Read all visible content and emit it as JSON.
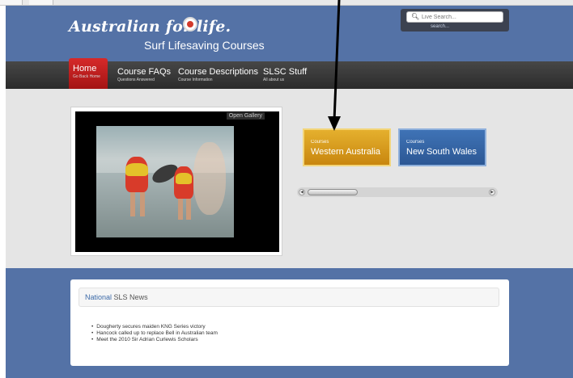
{
  "header": {
    "logo_script": "Australian for life.",
    "logo_subtitle": "Surf Lifesaving Courses",
    "search_placeholder": "Live Search...",
    "search_link": "search..."
  },
  "nav": {
    "items": [
      {
        "label": "Home",
        "sublabel": "Go Back Home"
      },
      {
        "label": "Course FAQs",
        "sublabel": "Questions Answered"
      },
      {
        "label": "Course Descriptions",
        "sublabel": "Course Information"
      },
      {
        "label": "SLSC Stuff",
        "sublabel": "All about us"
      }
    ]
  },
  "gallery": {
    "open_label": "Open Gallery"
  },
  "courses": [
    {
      "caption": "Courses",
      "title": "Western Australia",
      "color": "#d9a020"
    },
    {
      "caption": "Courses",
      "title": "New South Wales",
      "color": "#3566a8"
    }
  ],
  "news": {
    "heading_accent": "National",
    "heading_rest": "SLS News",
    "items": [
      "Dougherty secures maiden KNG Series victory",
      "Hancock called up to replace Bell in Australian team",
      "Meet the 2010 Sir Adrian Curlewis Scholars"
    ]
  },
  "colors": {
    "brand_blue": "#5472a6",
    "nav_dark": "#333333",
    "home_red": "#c21d1d"
  }
}
